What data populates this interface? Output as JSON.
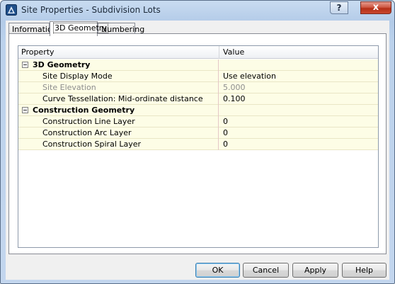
{
  "window": {
    "title": "Site Properties - Subdivision Lots"
  },
  "titlebar_buttons": {
    "help": "?",
    "close": "x"
  },
  "tabs": [
    {
      "label": "Information",
      "active": false
    },
    {
      "label": "3D Geometry",
      "active": true
    },
    {
      "label": "Numbering",
      "active": false
    }
  ],
  "grid": {
    "headers": {
      "property": "Property",
      "value": "Value"
    },
    "rows": [
      {
        "type": "category",
        "property": "3D Geometry",
        "value": ""
      },
      {
        "type": "item",
        "property": "Site Display Mode",
        "value": "Use elevation",
        "disabled": false
      },
      {
        "type": "item",
        "property": "Site Elevation",
        "value": "5.000",
        "disabled": true
      },
      {
        "type": "item",
        "property": "Curve Tessellation: Mid-ordinate distance",
        "value": "0.100",
        "disabled": false
      },
      {
        "type": "category",
        "property": "Construction Geometry",
        "value": ""
      },
      {
        "type": "item",
        "property": "Construction Line Layer",
        "value": "0",
        "disabled": false
      },
      {
        "type": "item",
        "property": "Construction Arc Layer",
        "value": "0",
        "disabled": false
      },
      {
        "type": "item",
        "property": "Construction Spiral Layer",
        "value": "0",
        "disabled": false
      }
    ]
  },
  "buttons": {
    "ok": "OK",
    "cancel": "Cancel",
    "apply": "Apply",
    "help": "Help"
  },
  "icons": {
    "app": "civil3d-icon",
    "expand": "collapse-icon"
  },
  "colors": {
    "row_background": "#fdfde6",
    "disabled_text": "#8d8d8d",
    "close_button": "#c9472e"
  }
}
